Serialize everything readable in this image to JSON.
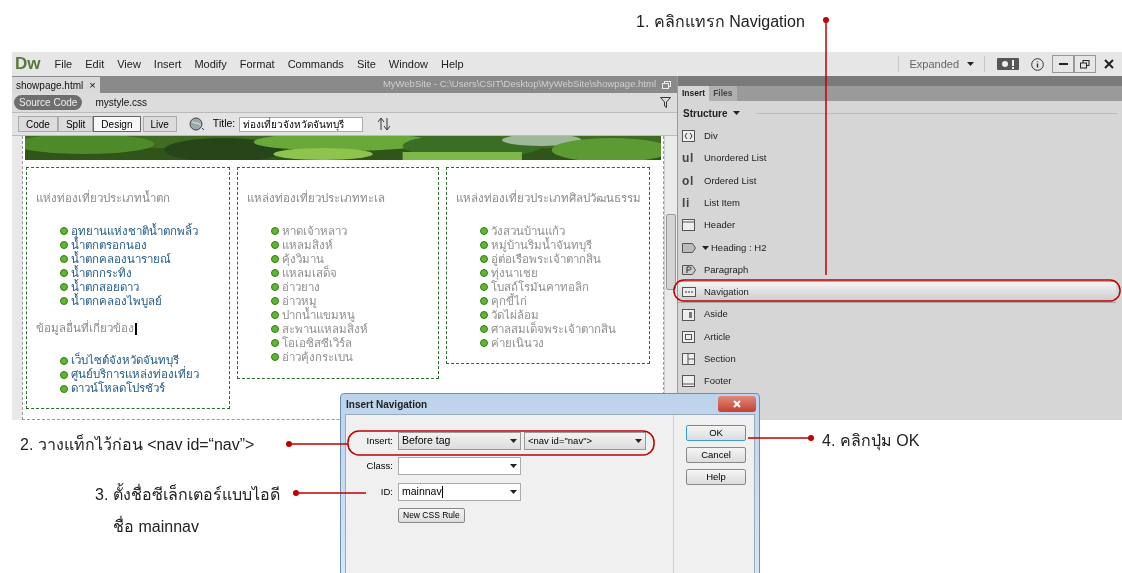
{
  "callouts": [
    {
      "text": "1. คลิกแทรก Navigation"
    },
    {
      "text": "2. วางแท็กไว้ก่อน <nav id=“nav”>"
    },
    {
      "text": "3. ตั้งชื่อซีเล็กเตอร์แบบไอดี",
      "line2": "ชื่อ mainnav"
    },
    {
      "text": "4. คลิกปุ่ม OK"
    }
  ],
  "app": {
    "logo": "Dw",
    "menu": [
      "File",
      "Edit",
      "View",
      "Insert",
      "Modify",
      "Format",
      "Commands",
      "Site",
      "Window",
      "Help"
    ],
    "workspace": "Expanded"
  },
  "document": {
    "tab": "showpage.html",
    "tab_close": "×",
    "path": "MyWebSite - C:\\Users\\CSIT\\Desktop\\MyWebSite\\showpage.html",
    "related_files": [
      {
        "label": "Source Code",
        "selected": true
      },
      {
        "label": "mystyle.css",
        "selected": false
      }
    ],
    "view_buttons": [
      {
        "label": "Code",
        "selected": false
      },
      {
        "label": "Split",
        "selected": false
      },
      {
        "label": "Design",
        "selected": true
      },
      {
        "label": "Live",
        "selected": false
      }
    ],
    "title_label": "Title:",
    "title_value": "ท่องเที่ยวจังหวัดจันทบุรี"
  },
  "page_columns": [
    {
      "sections": [
        {
          "heading": "แห่งท่องเที่ยวประเภทน้ำตก",
          "linked": true,
          "items": [
            "อุทยานแห่งชาติน้ำตกพลิ้ว",
            "น้ำตกตรอกนอง",
            "น้ำตกคลองนารายณ์",
            "น้ำตกกระทิง",
            "น้ำตกสอยดาว",
            "น้ำตกคลองไพบูลย์"
          ]
        },
        {
          "heading": "ข้อมูลอื่นที่เกี่ยวข้อง",
          "linked": true,
          "items": [
            "เว็บไซต์จังหวัดจันทบุรี",
            "ศูนย์บริการแหล่งท่องเที่ยว",
            "ดาวน์โหลดโปรชัวร์"
          ]
        }
      ]
    },
    {
      "sections": [
        {
          "heading": "แหล่งท่องเที่ยวประเภททะเล",
          "linked": false,
          "items": [
            "หาดเจ้าหลาว",
            "แหลมสิงห์",
            "คุ้งวิมาน",
            "แหลมเสด็จ",
            "อ่าวยาง",
            "อ่าวหมู",
            "ปากน้ำแขมหนู",
            "สะพานแหลมสิงห์",
            "โอเอซิสซีเวิร์ล",
            "อ่าวคุ้งกระเบน"
          ]
        }
      ]
    },
    {
      "sections": [
        {
          "heading": "แหล่งท่องเที่ยวประเภทศิลปวัฒนธรรม",
          "linked": false,
          "items": [
            "วังสวนบ้านแก้ว",
            "หมู่บ้านริมน้ำจันทบุรี",
            "อู่ต่อเรือพระเจ้าตากสิน",
            "ทุ่งนาเชย",
            "โบสถ์โรมันคาทอลิก",
            "คุกขี้ไก่",
            "วัดไผ่ล้อม",
            "ศาลสมเด็จพระเจ้าตากสิน",
            "ค่ายเนินวง"
          ]
        }
      ]
    }
  ],
  "panel": {
    "tabs": [
      {
        "label": "Insert",
        "selected": true
      },
      {
        "label": "Files",
        "selected": false
      }
    ],
    "category": "Structure",
    "items": [
      {
        "kind": "div",
        "label": "Div",
        "selected": false
      },
      {
        "kind": "glyph",
        "glyph": "ul",
        "label": "Unordered List",
        "selected": false
      },
      {
        "kind": "glyph",
        "glyph": "ol",
        "label": "Ordered List",
        "selected": false
      },
      {
        "kind": "glyph",
        "glyph": "li",
        "label": "List Item",
        "selected": false
      },
      {
        "kind": "header",
        "label": "Header",
        "selected": false
      },
      {
        "kind": "heading",
        "label": "Heading : H2",
        "selected": false
      },
      {
        "kind": "paragraph",
        "label": "Paragraph",
        "selected": false
      },
      {
        "kind": "nav",
        "label": "Navigation",
        "selected": true
      },
      {
        "kind": "aside",
        "label": "Aside",
        "selected": false
      },
      {
        "kind": "article",
        "label": "Article",
        "selected": false
      },
      {
        "kind": "section",
        "label": "Section",
        "selected": false
      },
      {
        "kind": "footer",
        "label": "Footer",
        "selected": false
      }
    ]
  },
  "dialog": {
    "title": "Insert Navigation",
    "insert_label": "Insert:",
    "insert_position": "Before tag",
    "insert_tag": "<nav id=\"nav\">",
    "class_label": "Class:",
    "id_label": "ID:",
    "id_value": "mainnav",
    "new_rule": "New CSS Rule",
    "buttons": [
      "OK",
      "Cancel",
      "Help"
    ]
  }
}
